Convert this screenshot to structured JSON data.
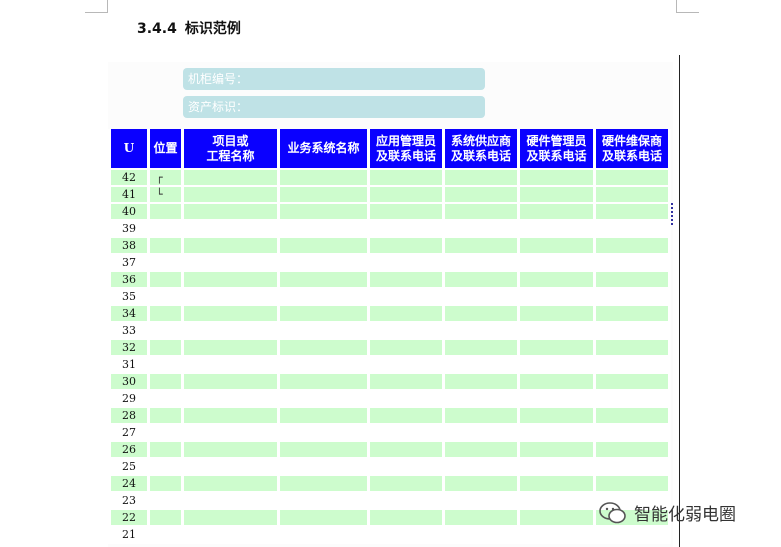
{
  "section": {
    "number": "3.4.4",
    "title": "标识范例"
  },
  "info_fields": [
    {
      "label": "机柜编号："
    },
    {
      "label": "资产标识："
    }
  ],
  "table": {
    "headers": [
      "U",
      "位置",
      "项目或\n工程名称",
      "业务系统名称",
      "应用管理员\n及联系电话",
      "系统供应商\n及联系电话",
      "硬件管理员\n及联系电话",
      "硬件维保商\n及联系电话"
    ],
    "rows": [
      {
        "u": "42",
        "pos": "┌",
        "shade": true
      },
      {
        "u": "41",
        "pos": "└",
        "shade": true
      },
      {
        "u": "40",
        "pos": "",
        "shade": true
      },
      {
        "u": "39",
        "pos": "",
        "shade": false
      },
      {
        "u": "38",
        "pos": "",
        "shade": true
      },
      {
        "u": "37",
        "pos": "",
        "shade": false
      },
      {
        "u": "36",
        "pos": "",
        "shade": true
      },
      {
        "u": "35",
        "pos": "",
        "shade": false
      },
      {
        "u": "34",
        "pos": "",
        "shade": true
      },
      {
        "u": "33",
        "pos": "",
        "shade": false
      },
      {
        "u": "32",
        "pos": "",
        "shade": true
      },
      {
        "u": "31",
        "pos": "",
        "shade": false
      },
      {
        "u": "30",
        "pos": "",
        "shade": true
      },
      {
        "u": "29",
        "pos": "",
        "shade": false
      },
      {
        "u": "28",
        "pos": "",
        "shade": true
      },
      {
        "u": "27",
        "pos": "",
        "shade": false
      },
      {
        "u": "26",
        "pos": "",
        "shade": true
      },
      {
        "u": "25",
        "pos": "",
        "shade": false
      },
      {
        "u": "24",
        "pos": "",
        "shade": true
      },
      {
        "u": "23",
        "pos": "",
        "shade": false
      },
      {
        "u": "22",
        "pos": "",
        "shade": true
      },
      {
        "u": "21",
        "pos": "",
        "shade": false
      }
    ]
  },
  "watermark": {
    "text": "智能化弱电圈",
    "icon": "wechat-icon"
  },
  "colors": {
    "header_bg": "#0a00ff",
    "row_shade": "#cdfccd",
    "field_bg": "#bfe2e6"
  }
}
